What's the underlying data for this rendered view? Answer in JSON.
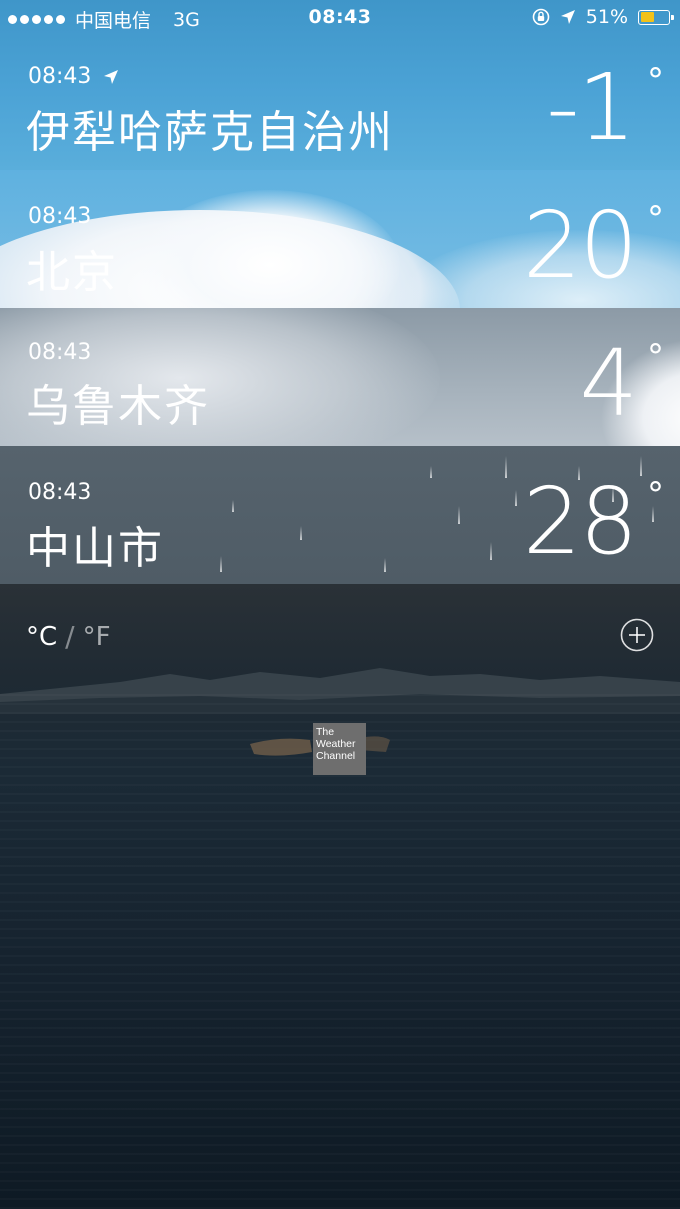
{
  "status_bar": {
    "carrier": "中国电信",
    "network": "3G",
    "time": "08:43",
    "battery_percent": "51%",
    "battery_level": 0.51,
    "battery_color": "#f2c21a",
    "icons": [
      "signal-dots",
      "rotation-lock-icon",
      "location-arrow-icon",
      "battery-icon"
    ]
  },
  "cities": [
    {
      "time": "08:43",
      "name": "伊犁哈萨克自治州",
      "temp": "-1",
      "degree": "°",
      "show_location_arrow": true,
      "condition_visual": "clear-sky"
    },
    {
      "time": "08:43",
      "name": "北京",
      "temp": "20",
      "degree": "°",
      "show_location_arrow": false,
      "condition_visual": "clouds"
    },
    {
      "time": "08:43",
      "name": "乌鲁木齐",
      "temp": "4",
      "degree": "°",
      "show_location_arrow": false,
      "condition_visual": "overcast"
    },
    {
      "time": "08:43",
      "name": "中山市",
      "temp": "28",
      "degree": "°",
      "show_location_arrow": false,
      "condition_visual": "rain"
    }
  ],
  "units": {
    "celsius": "°C",
    "separator": "/",
    "fahrenheit": "°F",
    "selected": "celsius"
  },
  "add_button_icon": "plus-circle-icon",
  "logo": {
    "line1": "The",
    "line2": "Weather",
    "line3": "Channel",
    "background": "#6e6e6e"
  }
}
